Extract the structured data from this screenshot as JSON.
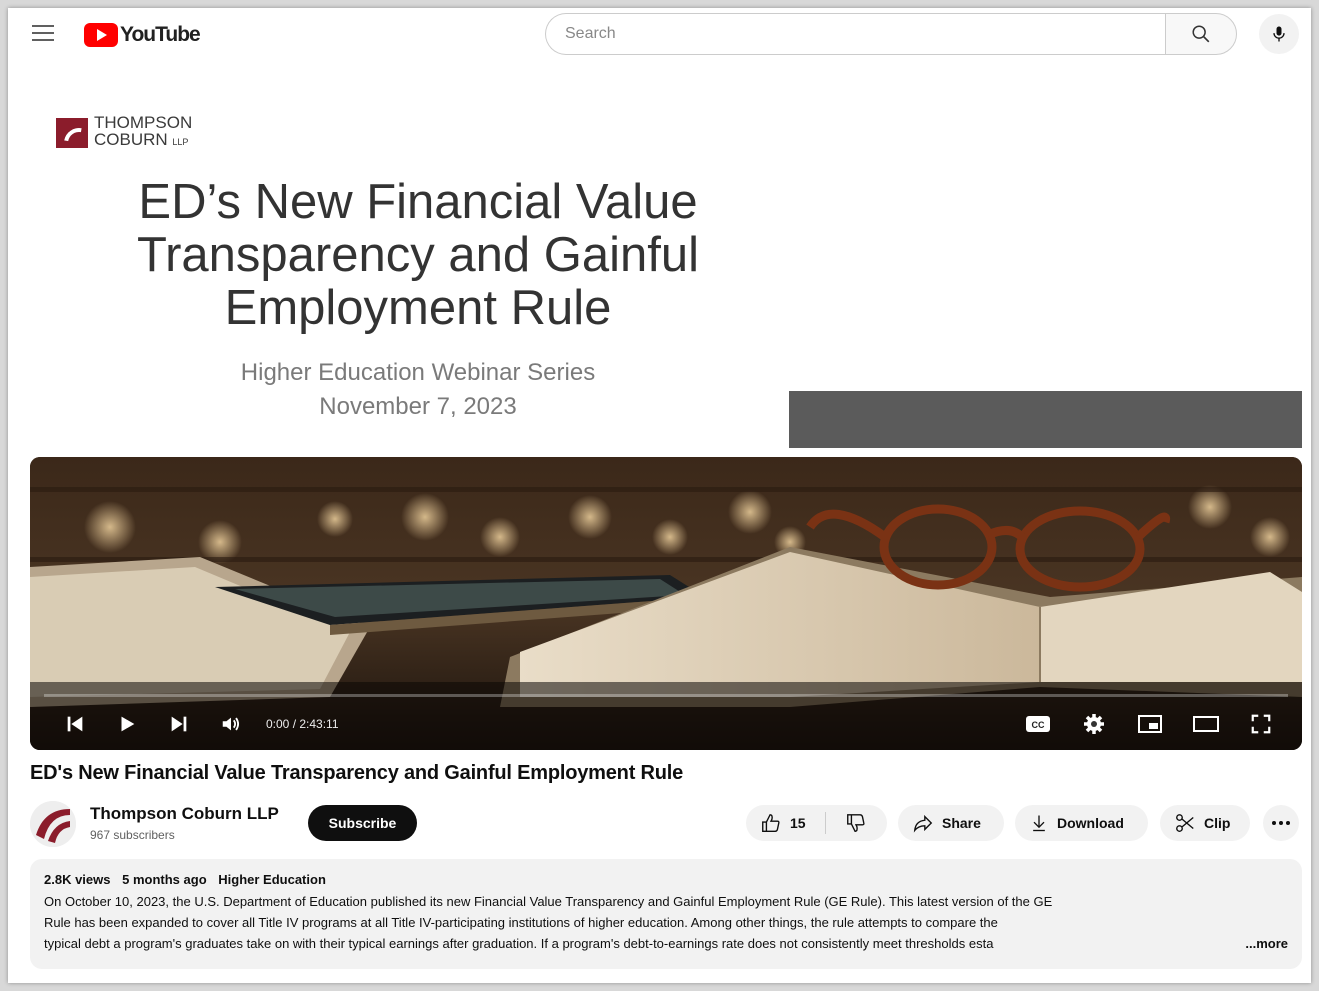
{
  "header": {
    "logo_text": "YouTube",
    "search_placeholder": "Search"
  },
  "slide": {
    "brand_line1": "THOMPSON",
    "brand_line2": "COBURN",
    "brand_suffix": "LLP",
    "title_line1": "ED’s New Financial Value",
    "title_line2": "Transparency and Gainful",
    "title_line3": "Employment Rule",
    "series": "Higher Education Webinar Series",
    "date": "November 7, 2023"
  },
  "player": {
    "time": "0:00 / 2:43:11",
    "progress": 0
  },
  "video": {
    "title": "ED's New Financial Value Transparency and Gainful Employment Rule"
  },
  "channel": {
    "name": "Thompson Coburn LLP",
    "subscribers": "967 subscribers",
    "subscribe_label": "Subscribe"
  },
  "actions": {
    "likes": "15",
    "share": "Share",
    "download": "Download",
    "clip": "Clip"
  },
  "description": {
    "views": "2.8K views",
    "age": "5 months ago",
    "category": "Higher Education",
    "line1": "On October 10, 2023, the U.S. Department of Education published its new Financial Value Transparency and Gainful Employment Rule (GE Rule). This latest version of the GE",
    "line2": "Rule has been expanded to cover all Title IV programs at all Title IV-participating institutions of higher education.  Among other things, the rule attempts to compare the",
    "line3": "typical debt a program's graduates take on with their typical earnings after graduation.  If a program's debt-to-earnings rate does not consistently meet thresholds esta",
    "more": "...more"
  },
  "colors": {
    "brand_red": "#ff0000",
    "firm_maroon": "#8b1c2b",
    "subscribe_bg": "#0f0f0f"
  }
}
